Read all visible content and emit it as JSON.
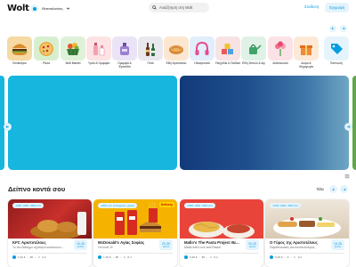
{
  "header": {
    "logo": "Wolt",
    "location": "Θεσσαλονίκη",
    "search_placeholder": "Αναζήτηση στη Wolt",
    "login_label": "Σύνδεση",
    "signup_label": "Εγγραφή"
  },
  "categories": [
    {
      "label": "Εστιατόρια",
      "bg": "#f6d9a3"
    },
    {
      "label": "Pizza",
      "bg": "#d8efcf"
    },
    {
      "label": "Wolt Market",
      "bg": "#dff1d9"
    },
    {
      "label": "Υγεία & Ομορφιά",
      "bg": "#fde3e3"
    },
    {
      "label": "Ομορφιά & Φροντίδα",
      "bg": "#ebe4f6"
    },
    {
      "label": "Ποτά",
      "bg": "#e8e8ee"
    },
    {
      "label": "Είδη Αρτοποιίου",
      "bg": "#fbe6cf"
    },
    {
      "label": "Ηλεκτρονικά",
      "bg": "#e1eefb"
    },
    {
      "label": "Παιχνίδια & Παιδικά",
      "bg": "#f7e3e4"
    },
    {
      "label": "Είδη Σπιτιού & Διy",
      "bg": "#e0f2e6"
    },
    {
      "label": "Ανθοπωλεία",
      "bg": "#fbe2e7"
    },
    {
      "label": "Δώρα & Ψυχαγωγία",
      "bg": "#fde9d7"
    },
    {
      "label": "Έκπτωση",
      "bg": "#e5f4fc"
    }
  ],
  "section": {
    "title": "Δείπνο κοντά σου",
    "see_all": "Όλα"
  },
  "venues": [
    {
      "promo": "-10% -20% -30% στο",
      "brand": "",
      "name": "KFC Αριστοτέλους",
      "subtitle": "Το πιο διάσημο τηγανητό κοτόπουλο...",
      "eta_time": "15-25",
      "eta_unit": "λεπτά",
      "fee": "0,49 €",
      "price": "€€",
      "rating": "9.0"
    },
    {
      "promo": "-20% στο επιλεγμένο μενού",
      "brand": "Delivery",
      "name": "McDonald's Αγίας Σοφίας",
      "subtitle": "I'm lovin' it!",
      "eta_time": "20-30",
      "eta_unit": "λεπτά",
      "fee": "1,99 €",
      "price": "€€",
      "rating": "8.4"
    },
    {
      "promo": "-10% -20% -30% στο",
      "brand": "",
      "name": "Mallo's The Pasta Project Θε...",
      "subtitle": "Made with Love and Pasta!",
      "eta_time": "15-25",
      "eta_unit": "λεπτά",
      "fee": "0,99 €",
      "price": "€€",
      "rating": "9.2"
    },
    {
      "promo": "-10% -20% -30% στο",
      "brand": "",
      "name": "Ο Γύρος της Αριστοτέλους",
      "subtitle": "Παραδοσιακός και πεντανόστιμος...",
      "eta_time": "15-25",
      "eta_unit": "λεπτά",
      "fee": "0,99 €",
      "price": "€",
      "rating": "9.4"
    }
  ],
  "colors": {
    "accent": "#039de0",
    "accent_light": "#e5f4fc",
    "banner_primary": "#16b6df"
  }
}
